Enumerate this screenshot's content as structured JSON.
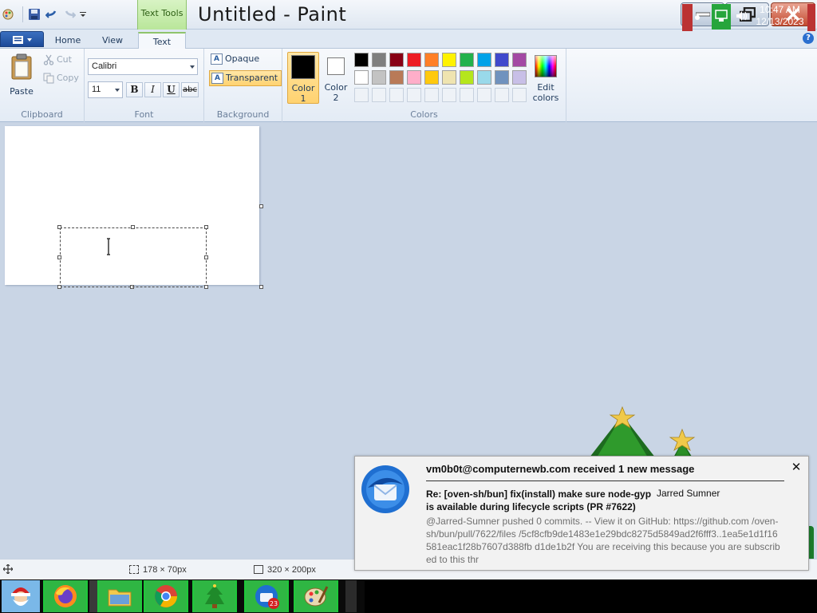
{
  "window": {
    "title": "Untitled - Paint",
    "contextual_tab": "Text Tools"
  },
  "tabs": [
    {
      "label": "Home"
    },
    {
      "label": "View"
    },
    {
      "label": "Text",
      "active": true
    }
  ],
  "ribbon": {
    "clipboard": {
      "group_label": "Clipboard",
      "paste": "Paste",
      "cut": "Cut",
      "copy": "Copy"
    },
    "font": {
      "group_label": "Font",
      "family": "Calibri",
      "size": "11",
      "bold": "B",
      "italic": "I",
      "underline": "U",
      "strikethrough": "abc"
    },
    "background": {
      "group_label": "Background",
      "opaque": "Opaque",
      "transparent": "Transparent",
      "selected": "Transparent"
    },
    "colors": {
      "group_label": "Colors",
      "color1_label": "Color\n1",
      "color1_line1": "Color",
      "color1_line2": "1",
      "color1_value": "#000000",
      "color2_line1": "Color",
      "color2_line2": "2",
      "color2_value": "#ffffff",
      "edit_line1": "Edit",
      "edit_line2": "colors",
      "palette_row1": [
        "#000000",
        "#7f7f7f",
        "#880015",
        "#ed1c24",
        "#ff7f27",
        "#fff200",
        "#22b14c",
        "#00a2e8",
        "#3f48cc",
        "#a349a4"
      ],
      "palette_row2": [
        "#ffffff",
        "#c3c3c3",
        "#b97a57",
        "#ffaec9",
        "#ffc90e",
        "#efe4b0",
        "#b5e61d",
        "#99d9ea",
        "#7092be",
        "#c8bfe7"
      ],
      "palette_row3_empty": 10
    }
  },
  "status": {
    "selection_size": "178 × 70px",
    "canvas_size": "320 × 200px"
  },
  "notification": {
    "header": "vm0b0t@computernewb.com received 1 new message",
    "subject": "Re: [oven-sh/bun] fix(install) make sure node-gyp is available during lifecycle scripts (PR #7622)",
    "sender": "Jarred Sumner",
    "body": "@Jarred-Sumner pushed 0 commits. -- View it on GitHub: https://github.com /oven-sh/bun/pull/7622/files /5cf8cfb9de1483e1e29bdc8275d5849ad2f6fff3..1ea5e1d1f16581eac1f28b7607d388fb d1de1b2f You are receiving this because you are subscribed to this thr"
  },
  "taskbar": {
    "apps": [
      "start-menu",
      "firefox",
      "file-explorer",
      "chrome",
      "christmas-tree",
      "thunderbird",
      "paint"
    ],
    "thunderbird_badge": "23",
    "clock_time": "10:47 AM",
    "clock_date": "12/13/2023"
  },
  "colors": {
    "accent_selected": "#ffd270",
    "contextual_green": "#b9e69a",
    "taskbar_green": "#2fb643"
  }
}
